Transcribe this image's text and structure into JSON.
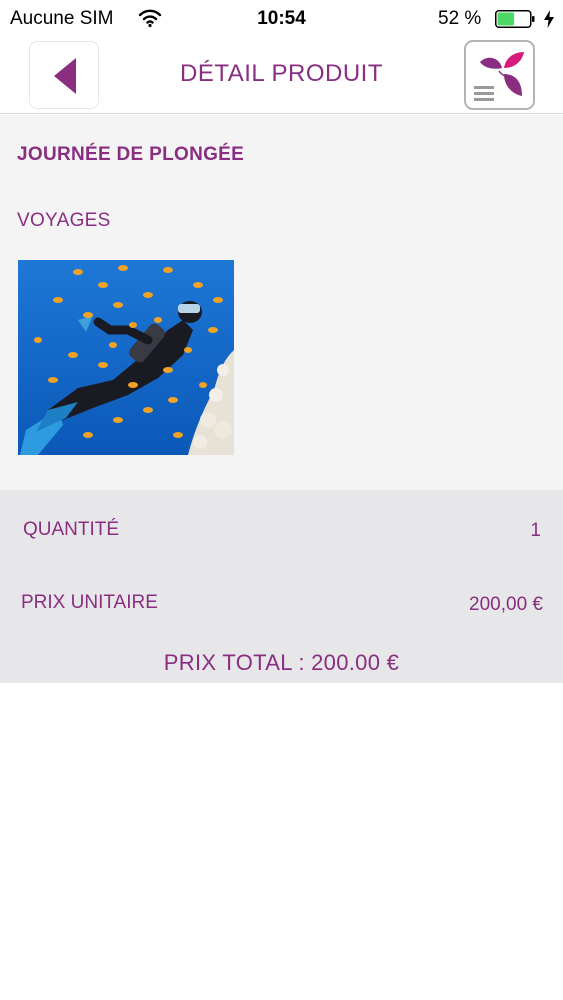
{
  "status_bar": {
    "carrier": "Aucune SIM",
    "time": "10:54",
    "battery_percent": "52 %",
    "battery_level": 0.52,
    "wifi_icon": "wifi-icon",
    "battery_icon": "battery-icon",
    "charging_icon": "charging-bolt-icon"
  },
  "nav_bar": {
    "title": "DÉTAIL PRODUIT",
    "back_icon": "chevron-left-icon",
    "menu_icon": "leaf-logo-menu-icon"
  },
  "product": {
    "title": "JOURNÉE DE PLONGÉE",
    "category": "VOYAGES",
    "image": "scuba-diver-photo"
  },
  "pricing": {
    "quantity_label": "QUANTITÉ",
    "quantity_value": "1",
    "unit_price_label": "PRIX UNITAIRE",
    "unit_price_value": "200,00 €",
    "total": "PRIX TOTAL : 200.00 €"
  },
  "colors": {
    "accent": "#8a2e82",
    "logo_pink": "#d81b7a",
    "section_bg": "#f4f4f5",
    "price_bg": "#e7e7e9",
    "battery_green": "#4cd964"
  }
}
